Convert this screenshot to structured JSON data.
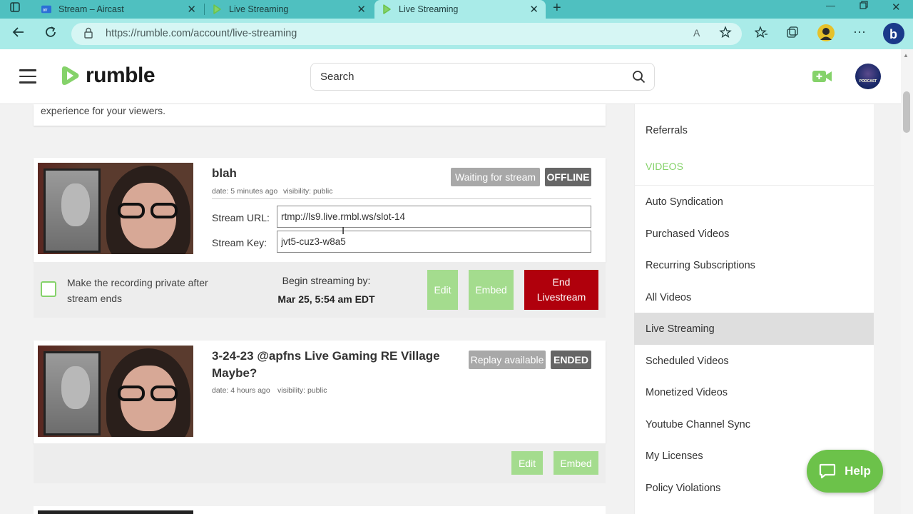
{
  "browser": {
    "tabs": [
      {
        "label": "Stream – Aircast"
      },
      {
        "label": "Live Streaming"
      },
      {
        "label": "Live Streaming"
      }
    ],
    "url": "https://rumble.com/account/live-streaming"
  },
  "header": {
    "logo_text": "rumble",
    "search_placeholder": "Search"
  },
  "main": {
    "intro_text": "experience for your viewers.",
    "streams": [
      {
        "title": "blah",
        "date": "date: 5 minutes ago",
        "visibility": "visibility: public",
        "status_label": "Waiting for stream",
        "state_label": "OFFLINE",
        "stream_url_label": "Stream URL:",
        "stream_url": "rtmp://ls9.live.rmbl.ws/slot-14",
        "stream_key_label": "Stream Key:",
        "stream_key": "jvt5-cuz3-w8a5",
        "private_label": "Make the recording private after stream ends",
        "begin_label": "Begin streaming by:",
        "begin_value": "Mar 25, 5:54 am EDT",
        "edit_label": "Edit",
        "embed_label": "Embed",
        "end_label": "End Livestream"
      },
      {
        "title": "3-24-23 @apfns Live Gaming RE Village Maybe?",
        "date": "date: 4 hours ago",
        "visibility": "visibility: public",
        "status_label": "Replay available",
        "state_label": "ENDED",
        "edit_label": "Edit",
        "embed_label": "Embed"
      }
    ]
  },
  "sidebar": {
    "items": [
      {
        "label": "Referrals"
      },
      {
        "label": "Auto Syndication"
      },
      {
        "label": "Purchased Videos"
      },
      {
        "label": "Recurring Subscriptions"
      },
      {
        "label": "All Videos"
      },
      {
        "label": "Live Streaming",
        "active": true
      },
      {
        "label": "Scheduled Videos"
      },
      {
        "label": "Monetized Videos"
      },
      {
        "label": "Youtube Channel Sync"
      },
      {
        "label": "My Licenses"
      },
      {
        "label": "Policy Violations"
      }
    ],
    "section_videos": "VIDEOS"
  },
  "help": {
    "label": "Help"
  },
  "avatar_text": "PODCAST",
  "colors": {
    "accent_green": "#85d26a",
    "danger_red": "#b0000c",
    "browser_teal": "#4fc0c0"
  }
}
